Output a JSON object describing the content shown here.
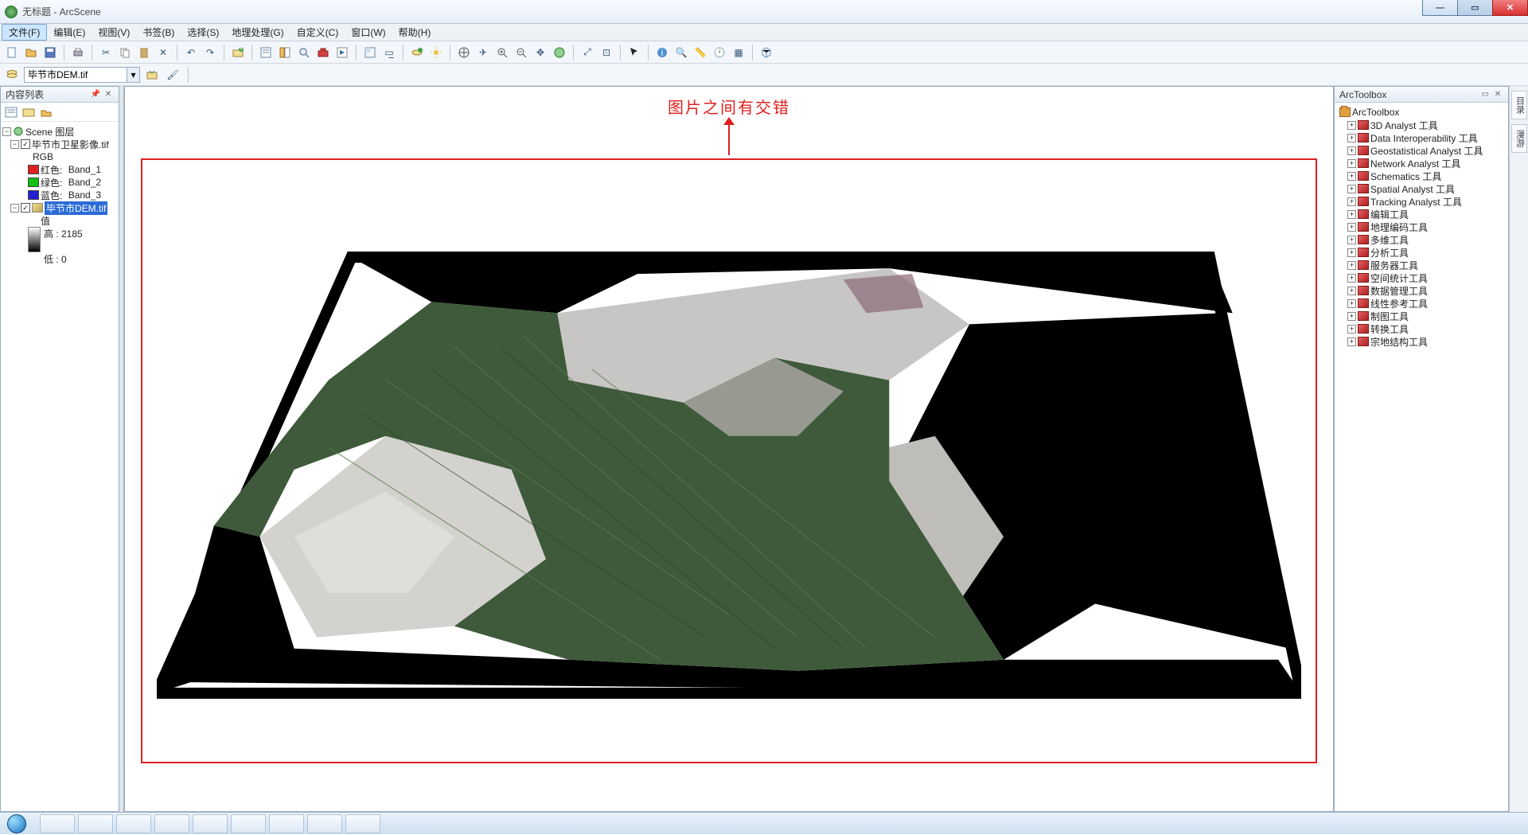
{
  "window": {
    "title": "无标题 - ArcScene"
  },
  "menus": [
    {
      "label": "文件(F)",
      "active": true
    },
    {
      "label": "编辑(E)"
    },
    {
      "label": "视图(V)"
    },
    {
      "label": "书签(B)"
    },
    {
      "label": "选择(S)"
    },
    {
      "label": "地理处理(G)"
    },
    {
      "label": "自定义(C)"
    },
    {
      "label": "窗口(W)"
    },
    {
      "label": "帮助(H)"
    }
  ],
  "layer_combo": "毕节市DEM.tif",
  "toc": {
    "title": "内容列表",
    "root": "Scene 图层",
    "layer1": {
      "name": "毕节市卫星影像.tif",
      "rgb_label": "RGB",
      "bands": [
        {
          "color": "#e02020",
          "label": "红色:",
          "band": "Band_1"
        },
        {
          "color": "#10c010",
          "label": "绿色:",
          "band": "Band_2"
        },
        {
          "color": "#2020d0",
          "label": "蓝色:",
          "band": "Band_3"
        }
      ]
    },
    "layer2": {
      "name": "毕节市DEM.tif",
      "value_label": "值",
      "high": "高 : 2185",
      "low": "低 : 0"
    }
  },
  "annotation": "图片之间有交错",
  "arctoolbox": {
    "title": "ArcToolbox",
    "root": "ArcToolbox",
    "items": [
      "3D Analyst 工具",
      "Data Interoperability 工具",
      "Geostatistical Analyst 工具",
      "Network Analyst 工具",
      "Schematics 工具",
      "Spatial Analyst 工具",
      "Tracking Analyst 工具",
      "编辑工具",
      "地理编码工具",
      "多维工具",
      "分析工具",
      "服务器工具",
      "空间统计工具",
      "数据管理工具",
      "线性参考工具",
      "制图工具",
      "转换工具",
      "宗地结构工具"
    ]
  },
  "util_tabs": [
    "目录",
    "漫游"
  ]
}
